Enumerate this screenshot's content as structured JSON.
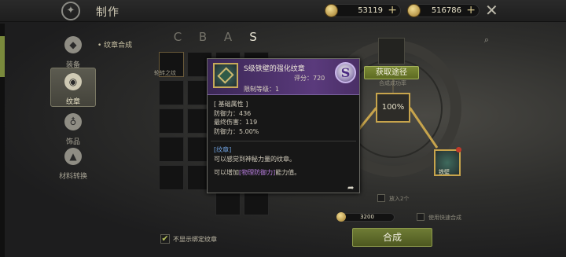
{
  "header": {
    "title": "制作",
    "currency_1": "53119",
    "currency_2": "516786"
  },
  "sidebar": {
    "items": [
      {
        "label": "装备",
        "icon": "armor-icon"
      },
      {
        "label": "纹章",
        "icon": "emblem-icon"
      },
      {
        "label": "饰品",
        "icon": "accessory-icon"
      },
      {
        "label": "材料转换",
        "icon": "anvil-icon"
      }
    ],
    "active_index": 1
  },
  "crafting": {
    "breadcrumb": "• 纹章合成",
    "grades": [
      "C",
      "B",
      "A",
      "S"
    ],
    "active_grade": "S",
    "first_cell_label": "轮转之纹",
    "hide_bound_label": "不显示绑定纹章",
    "hide_bound_checked": true
  },
  "tooltip": {
    "name": "S级铁壁的强化纹章",
    "score": "评分：720",
    "required_level": "限制等级：1",
    "grade": "S",
    "section_title": "[ 基础属性 ]",
    "stats": [
      "防御力：436",
      "最终伤害：119",
      "防御力：5.00%"
    ],
    "desc_tag": "[纹章]",
    "desc_line1": "可以感觉到神秘力量的纹章。",
    "desc_prefix": "可以增加",
    "desc_highlight": "[物理防御力]",
    "desc_suffix": "能力值。"
  },
  "synth": {
    "acquire_button": "获取途径",
    "rate_label": "合成成功率",
    "success_rate": "100%",
    "result_label": "铁壁",
    "add_label": "放入2个",
    "quick_label": "使用快速合成",
    "cost": "3200",
    "synth_button": "合成"
  },
  "colors": {
    "accent_green": "#6f7c35",
    "gold_frame": "#c7a44c",
    "purple_header": "#5a3a7c"
  }
}
